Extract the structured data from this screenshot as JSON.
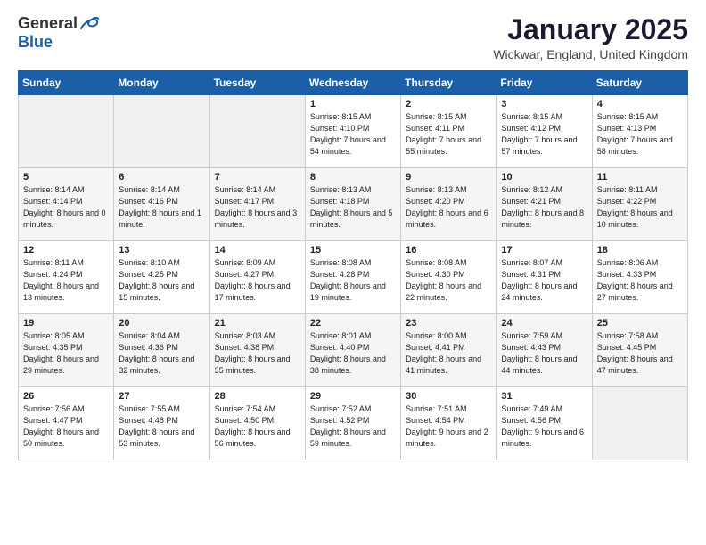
{
  "logo": {
    "general": "General",
    "blue": "Blue"
  },
  "title": "January 2025",
  "subtitle": "Wickwar, England, United Kingdom",
  "days_of_week": [
    "Sunday",
    "Monday",
    "Tuesday",
    "Wednesday",
    "Thursday",
    "Friday",
    "Saturday"
  ],
  "weeks": [
    [
      {
        "day": "",
        "sunrise": "",
        "sunset": "",
        "daylight": ""
      },
      {
        "day": "",
        "sunrise": "",
        "sunset": "",
        "daylight": ""
      },
      {
        "day": "",
        "sunrise": "",
        "sunset": "",
        "daylight": ""
      },
      {
        "day": "1",
        "sunrise": "Sunrise: 8:15 AM",
        "sunset": "Sunset: 4:10 PM",
        "daylight": "Daylight: 7 hours and 54 minutes."
      },
      {
        "day": "2",
        "sunrise": "Sunrise: 8:15 AM",
        "sunset": "Sunset: 4:11 PM",
        "daylight": "Daylight: 7 hours and 55 minutes."
      },
      {
        "day": "3",
        "sunrise": "Sunrise: 8:15 AM",
        "sunset": "Sunset: 4:12 PM",
        "daylight": "Daylight: 7 hours and 57 minutes."
      },
      {
        "day": "4",
        "sunrise": "Sunrise: 8:15 AM",
        "sunset": "Sunset: 4:13 PM",
        "daylight": "Daylight: 7 hours and 58 minutes."
      }
    ],
    [
      {
        "day": "5",
        "sunrise": "Sunrise: 8:14 AM",
        "sunset": "Sunset: 4:14 PM",
        "daylight": "Daylight: 8 hours and 0 minutes."
      },
      {
        "day": "6",
        "sunrise": "Sunrise: 8:14 AM",
        "sunset": "Sunset: 4:16 PM",
        "daylight": "Daylight: 8 hours and 1 minute."
      },
      {
        "day": "7",
        "sunrise": "Sunrise: 8:14 AM",
        "sunset": "Sunset: 4:17 PM",
        "daylight": "Daylight: 8 hours and 3 minutes."
      },
      {
        "day": "8",
        "sunrise": "Sunrise: 8:13 AM",
        "sunset": "Sunset: 4:18 PM",
        "daylight": "Daylight: 8 hours and 5 minutes."
      },
      {
        "day": "9",
        "sunrise": "Sunrise: 8:13 AM",
        "sunset": "Sunset: 4:20 PM",
        "daylight": "Daylight: 8 hours and 6 minutes."
      },
      {
        "day": "10",
        "sunrise": "Sunrise: 8:12 AM",
        "sunset": "Sunset: 4:21 PM",
        "daylight": "Daylight: 8 hours and 8 minutes."
      },
      {
        "day": "11",
        "sunrise": "Sunrise: 8:11 AM",
        "sunset": "Sunset: 4:22 PM",
        "daylight": "Daylight: 8 hours and 10 minutes."
      }
    ],
    [
      {
        "day": "12",
        "sunrise": "Sunrise: 8:11 AM",
        "sunset": "Sunset: 4:24 PM",
        "daylight": "Daylight: 8 hours and 13 minutes."
      },
      {
        "day": "13",
        "sunrise": "Sunrise: 8:10 AM",
        "sunset": "Sunset: 4:25 PM",
        "daylight": "Daylight: 8 hours and 15 minutes."
      },
      {
        "day": "14",
        "sunrise": "Sunrise: 8:09 AM",
        "sunset": "Sunset: 4:27 PM",
        "daylight": "Daylight: 8 hours and 17 minutes."
      },
      {
        "day": "15",
        "sunrise": "Sunrise: 8:08 AM",
        "sunset": "Sunset: 4:28 PM",
        "daylight": "Daylight: 8 hours and 19 minutes."
      },
      {
        "day": "16",
        "sunrise": "Sunrise: 8:08 AM",
        "sunset": "Sunset: 4:30 PM",
        "daylight": "Daylight: 8 hours and 22 minutes."
      },
      {
        "day": "17",
        "sunrise": "Sunrise: 8:07 AM",
        "sunset": "Sunset: 4:31 PM",
        "daylight": "Daylight: 8 hours and 24 minutes."
      },
      {
        "day": "18",
        "sunrise": "Sunrise: 8:06 AM",
        "sunset": "Sunset: 4:33 PM",
        "daylight": "Daylight: 8 hours and 27 minutes."
      }
    ],
    [
      {
        "day": "19",
        "sunrise": "Sunrise: 8:05 AM",
        "sunset": "Sunset: 4:35 PM",
        "daylight": "Daylight: 8 hours and 29 minutes."
      },
      {
        "day": "20",
        "sunrise": "Sunrise: 8:04 AM",
        "sunset": "Sunset: 4:36 PM",
        "daylight": "Daylight: 8 hours and 32 minutes."
      },
      {
        "day": "21",
        "sunrise": "Sunrise: 8:03 AM",
        "sunset": "Sunset: 4:38 PM",
        "daylight": "Daylight: 8 hours and 35 minutes."
      },
      {
        "day": "22",
        "sunrise": "Sunrise: 8:01 AM",
        "sunset": "Sunset: 4:40 PM",
        "daylight": "Daylight: 8 hours and 38 minutes."
      },
      {
        "day": "23",
        "sunrise": "Sunrise: 8:00 AM",
        "sunset": "Sunset: 4:41 PM",
        "daylight": "Daylight: 8 hours and 41 minutes."
      },
      {
        "day": "24",
        "sunrise": "Sunrise: 7:59 AM",
        "sunset": "Sunset: 4:43 PM",
        "daylight": "Daylight: 8 hours and 44 minutes."
      },
      {
        "day": "25",
        "sunrise": "Sunrise: 7:58 AM",
        "sunset": "Sunset: 4:45 PM",
        "daylight": "Daylight: 8 hours and 47 minutes."
      }
    ],
    [
      {
        "day": "26",
        "sunrise": "Sunrise: 7:56 AM",
        "sunset": "Sunset: 4:47 PM",
        "daylight": "Daylight: 8 hours and 50 minutes."
      },
      {
        "day": "27",
        "sunrise": "Sunrise: 7:55 AM",
        "sunset": "Sunset: 4:48 PM",
        "daylight": "Daylight: 8 hours and 53 minutes."
      },
      {
        "day": "28",
        "sunrise": "Sunrise: 7:54 AM",
        "sunset": "Sunset: 4:50 PM",
        "daylight": "Daylight: 8 hours and 56 minutes."
      },
      {
        "day": "29",
        "sunrise": "Sunrise: 7:52 AM",
        "sunset": "Sunset: 4:52 PM",
        "daylight": "Daylight: 8 hours and 59 minutes."
      },
      {
        "day": "30",
        "sunrise": "Sunrise: 7:51 AM",
        "sunset": "Sunset: 4:54 PM",
        "daylight": "Daylight: 9 hours and 2 minutes."
      },
      {
        "day": "31",
        "sunrise": "Sunrise: 7:49 AM",
        "sunset": "Sunset: 4:56 PM",
        "daylight": "Daylight: 9 hours and 6 minutes."
      },
      {
        "day": "",
        "sunrise": "",
        "sunset": "",
        "daylight": ""
      }
    ]
  ]
}
